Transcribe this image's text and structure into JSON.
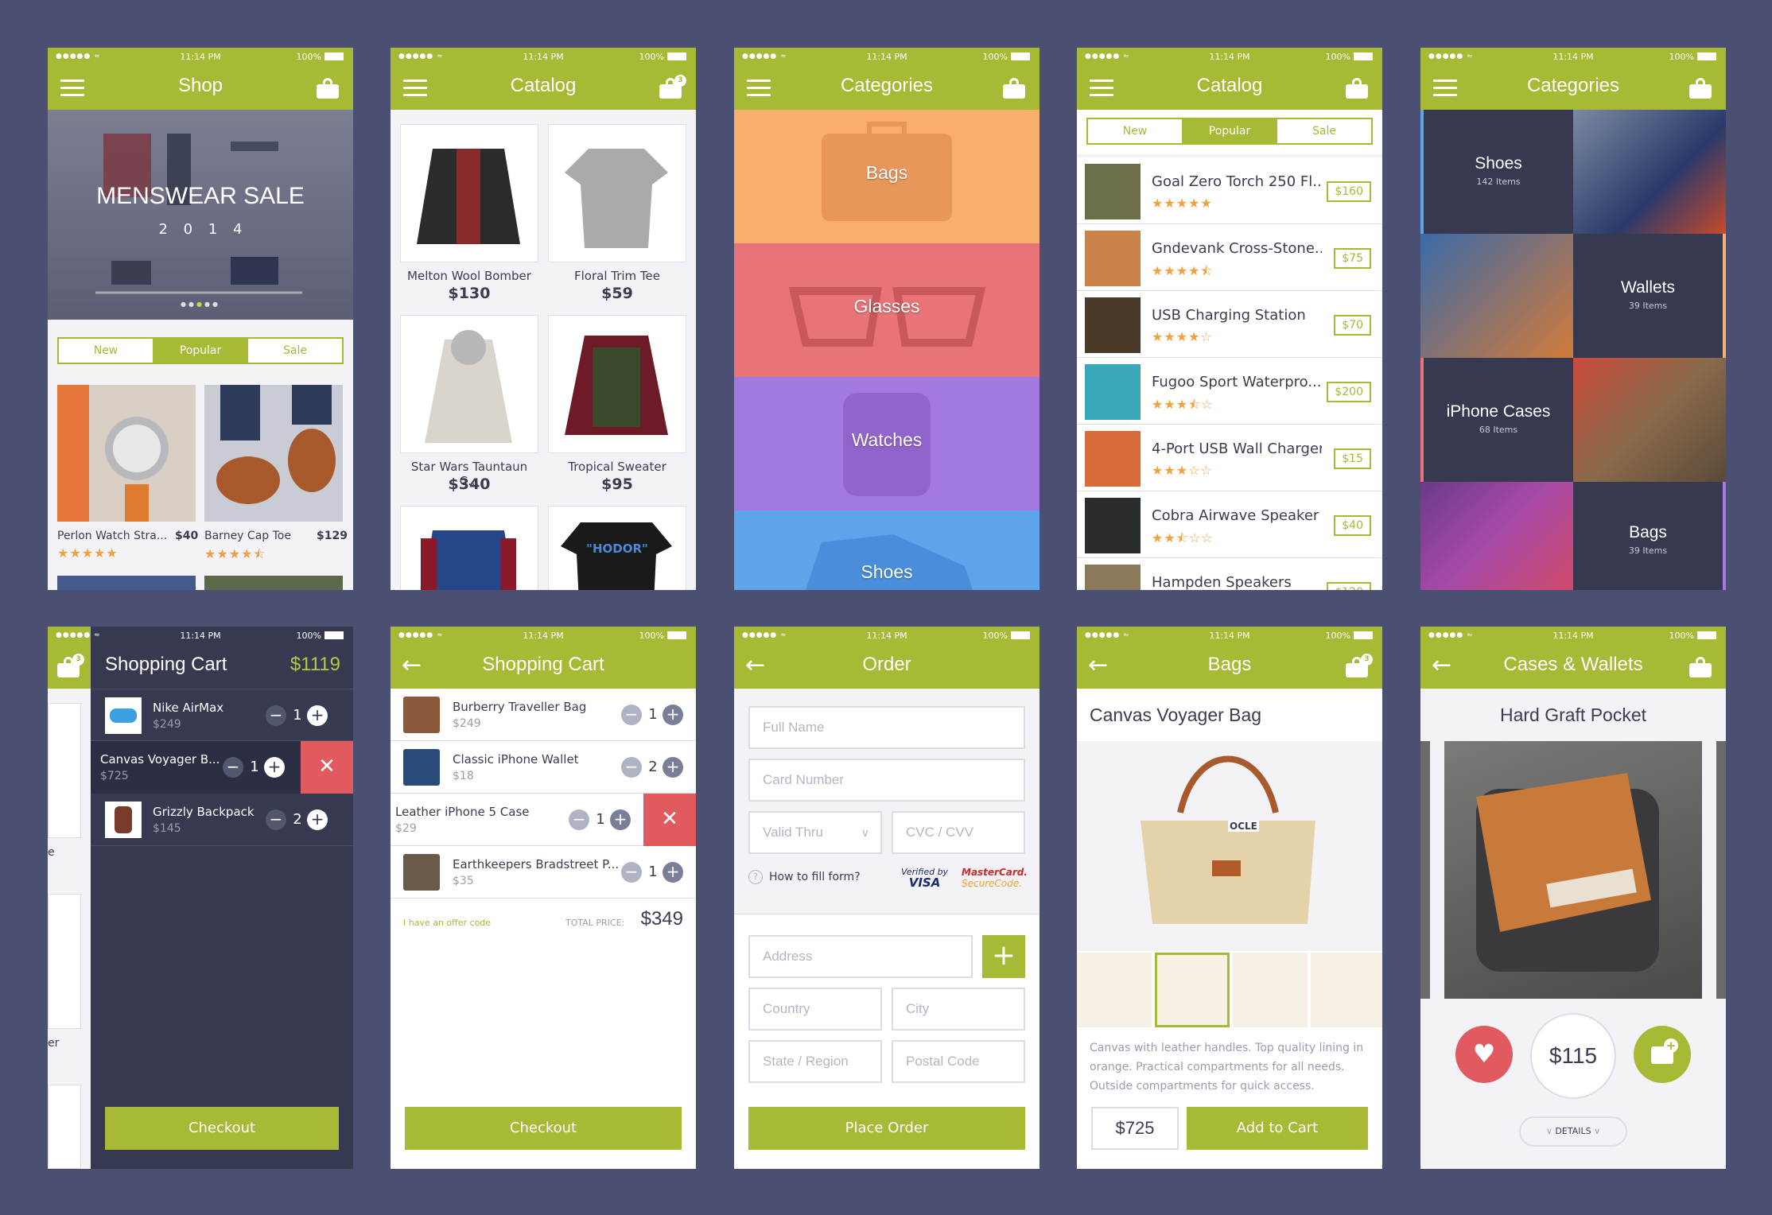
{
  "status": {
    "time": "11:14 PM",
    "battery": "100%"
  },
  "shop": {
    "title": "Shop",
    "banner_title": "MENSWEAR SALE",
    "banner_year": "2 0 1 4",
    "tabs": [
      "New",
      "Popular",
      "Sale"
    ],
    "products": [
      {
        "name": "Perlon Watch Stra...",
        "price": "$40",
        "stars": "★★★★★"
      },
      {
        "name": "Barney Cap Toe",
        "price": "$129",
        "stars": "★★★★⯪"
      }
    ]
  },
  "catalog1": {
    "title": "Catalog",
    "badge": "3",
    "items": [
      {
        "name": "Melton Wool Bomber",
        "price": "$130"
      },
      {
        "name": "Floral Trim Tee",
        "price": "$59"
      },
      {
        "name": "Star Wars Tauntaun C...",
        "price": "$340"
      },
      {
        "name": "Tropical Sweater",
        "price": "$95"
      }
    ],
    "tee_text": "\"HODOR\""
  },
  "categories1": {
    "title": "Categories",
    "items": [
      {
        "label": "Bags",
        "color": "#f8ae6c"
      },
      {
        "label": "Glasses",
        "color": "#e97478"
      },
      {
        "label": "Watches",
        "color": "#a378df"
      },
      {
        "label": "Shoes",
        "color": "#5fa3ea"
      }
    ]
  },
  "catalog2": {
    "title": "Catalog",
    "tabs": [
      "New",
      "Popular",
      "Sale"
    ],
    "items": [
      {
        "name": "Goal Zero Torch 250 Fl...",
        "stars": "★★★★★",
        "price": "$160"
      },
      {
        "name": "Gndevank Cross-Stone...",
        "stars": "★★★★⯪",
        "price": "$75"
      },
      {
        "name": "USB Charging Station",
        "stars": "★★★★☆",
        "price": "$70"
      },
      {
        "name": "Fugoo Sport Waterpro...",
        "stars": "★★★⯪☆",
        "price": "$200"
      },
      {
        "name": "4-Port USB Wall Charger",
        "stars": "★★★☆☆",
        "price": "$15"
      },
      {
        "name": "Cobra Airwave Speaker",
        "stars": "★★⯪☆☆",
        "price": "$40"
      },
      {
        "name": "Hampden Speakers",
        "stars": "",
        "price": "$120"
      }
    ]
  },
  "categories2": {
    "title": "Categories",
    "tiles": [
      {
        "label": "Shoes",
        "count": "142 Items"
      },
      {
        "label": "Wallets",
        "count": "39 Items"
      },
      {
        "label": "iPhone Cases",
        "count": "68 Items"
      },
      {
        "label": "Bags",
        "count": "39 Items"
      }
    ]
  },
  "cart_dark": {
    "title": "Shopping Cart",
    "total": "$1119",
    "badge": "3",
    "items": [
      {
        "name": "Nike AirMax",
        "price": "$249",
        "qty": "1"
      },
      {
        "name": "Canvas Voyager B...",
        "price": "$725",
        "qty": "1"
      },
      {
        "name": "Grizzly Backpack",
        "price": "$145",
        "qty": "2"
      }
    ],
    "checkout": "Checkout",
    "peek": [
      "e",
      "er"
    ]
  },
  "cart_light": {
    "title": "Shopping Cart",
    "items": [
      {
        "name": "Burberry Traveller Bag",
        "price": "$249",
        "qty": "1"
      },
      {
        "name": "Classic iPhone Wallet",
        "price": "$18",
        "qty": "2"
      },
      {
        "name": "Leather iPhone 5 Case",
        "price": "$29",
        "qty": "1"
      },
      {
        "name": "Earthkeepers Bradstreet P...",
        "price": "$35",
        "qty": "1"
      }
    ],
    "offer": "I have an offer code",
    "total_label": "TOTAL PRICE:",
    "total": "$349",
    "checkout": "Checkout"
  },
  "order": {
    "title": "Order",
    "full_name": "Full Name",
    "card_number": "Card Number",
    "valid_thru": "Valid Thru",
    "cvc": "CVC / CVV",
    "help": "How to fill form?",
    "visa_1": "Verified by",
    "visa_2": "VISA",
    "mc_1": "MasterCard.",
    "mc_2": "SecureCode.",
    "address": "Address",
    "country": "Country",
    "city": "City",
    "state": "State / Region",
    "postal": "Postal Code",
    "place": "Place Order"
  },
  "bags": {
    "title": "Bags",
    "badge": "3",
    "product": "Canvas Voyager Bag",
    "desc": "Canvas with leather handles. Top quality lining in orange. Practical compartments for all needs. Outside compartments for quick access.",
    "price": "$725",
    "add": "Add to Cart",
    "bag_tag": "OCLE"
  },
  "cases": {
    "title": "Cases & Wallets",
    "product": "Hard Graft Pocket",
    "price": "$115",
    "details": "DETAILS"
  }
}
